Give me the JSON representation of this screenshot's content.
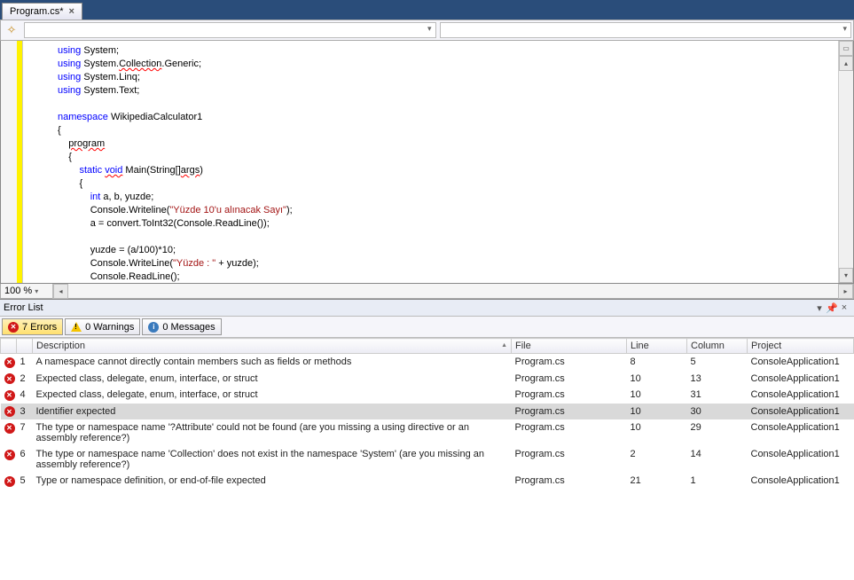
{
  "tab": {
    "title": "Program.cs*",
    "close": "×"
  },
  "zoom": "100 %",
  "code_lines": [
    {
      "indent": 0,
      "tokens": [
        {
          "t": "using ",
          "c": "kw"
        },
        {
          "t": "System;"
        }
      ],
      "box": "-",
      "boxLeft": -30
    },
    {
      "indent": 0,
      "tokens": [
        {
          "t": "using ",
          "c": "kw"
        },
        {
          "t": "System."
        },
        {
          "t": "Collection",
          "c": "squiggle"
        },
        {
          "t": ".Generic;"
        }
      ]
    },
    {
      "indent": 0,
      "tokens": [
        {
          "t": "using ",
          "c": "kw"
        },
        {
          "t": "System.Linq;"
        }
      ]
    },
    {
      "indent": 0,
      "tokens": [
        {
          "t": "using ",
          "c": "kw"
        },
        {
          "t": "System.Text;"
        }
      ]
    },
    {
      "indent": 0,
      "tokens": []
    },
    {
      "indent": 0,
      "tokens": [
        {
          "t": "namespace ",
          "c": "kw"
        },
        {
          "t": "WikipediaCalculator1"
        }
      ],
      "box": "-",
      "boxLeft": -30
    },
    {
      "indent": 0,
      "tokens": [
        {
          "t": "{"
        }
      ]
    },
    {
      "indent": 1,
      "tokens": [
        {
          "t": "program",
          "c": "squiggle"
        }
      ]
    },
    {
      "indent": 1,
      "tokens": [
        {
          "t": "{"
        }
      ]
    },
    {
      "indent": 2,
      "tokens": [
        {
          "t": "static ",
          "c": "kw"
        },
        {
          "t": "void",
          "c": "kw squiggle"
        },
        {
          "t": " Main(String"
        },
        {
          "t": "[]",
          "c": "squiggle"
        },
        {
          "t": "args",
          "c": "squiggle"
        },
        {
          "t": ")"
        }
      ]
    },
    {
      "indent": 2,
      "tokens": [
        {
          "t": "{"
        }
      ]
    },
    {
      "indent": 3,
      "tokens": [
        {
          "t": "int ",
          "c": "kw"
        },
        {
          "t": "a, b, yuzde;"
        }
      ]
    },
    {
      "indent": 3,
      "tokens": [
        {
          "t": "Console.Writeline("
        },
        {
          "t": "\"Yüzde 10'u alınacak Sayı\"",
          "c": "str"
        },
        {
          "t": ");"
        }
      ]
    },
    {
      "indent": 3,
      "tokens": [
        {
          "t": "a = convert.ToInt32(Console.ReadLine());"
        }
      ]
    },
    {
      "indent": 0,
      "tokens": []
    },
    {
      "indent": 3,
      "tokens": [
        {
          "t": "yuzde = (a/100)*10;"
        }
      ]
    },
    {
      "indent": 3,
      "tokens": [
        {
          "t": "Console.WriteLine("
        },
        {
          "t": "\"Yüzde : \"",
          "c": "str"
        },
        {
          "t": " + yuzde);"
        }
      ]
    },
    {
      "indent": 3,
      "tokens": [
        {
          "t": "Console.ReadLine();"
        }
      ]
    },
    {
      "indent": 3,
      "tokens": [
        {
          "t": "}"
        }
      ]
    },
    {
      "indent": 2,
      "tokens": [
        {
          "t": "}"
        }
      ]
    },
    {
      "indent": 1,
      "tokens": [
        {
          "t": "}",
          "c": "squiggle"
        }
      ]
    }
  ],
  "error_panel": {
    "title": "Error List",
    "filters": {
      "errors": "7 Errors",
      "warnings": "0 Warnings",
      "messages": "0 Messages"
    },
    "columns": [
      "",
      "",
      "Description",
      "File",
      "Line",
      "Column",
      "Project"
    ],
    "rows": [
      {
        "n": "1",
        "desc": "A namespace cannot directly contain members such as fields or methods",
        "file": "Program.cs",
        "line": "8",
        "col": "5",
        "proj": "ConsoleApplication1"
      },
      {
        "n": "2",
        "desc": "Expected class, delegate, enum, interface, or struct",
        "file": "Program.cs",
        "line": "10",
        "col": "13",
        "proj": "ConsoleApplication1"
      },
      {
        "n": "4",
        "desc": "Expected class, delegate, enum, interface, or struct",
        "file": "Program.cs",
        "line": "10",
        "col": "31",
        "proj": "ConsoleApplication1"
      },
      {
        "n": "3",
        "desc": "Identifier expected",
        "file": "Program.cs",
        "line": "10",
        "col": "30",
        "proj": "ConsoleApplication1",
        "sel": true
      },
      {
        "n": "7",
        "desc": "The type or namespace name '?Attribute' could not be found (are you missing a using directive or an assembly reference?)",
        "file": "Program.cs",
        "line": "10",
        "col": "29",
        "proj": "ConsoleApplication1"
      },
      {
        "n": "6",
        "desc": "The type or namespace name 'Collection' does not exist in the namespace 'System' (are you missing an assembly reference?)",
        "file": "Program.cs",
        "line": "2",
        "col": "14",
        "proj": "ConsoleApplication1"
      },
      {
        "n": "5",
        "desc": "Type or namespace definition, or end-of-file expected",
        "file": "Program.cs",
        "line": "21",
        "col": "1",
        "proj": "ConsoleApplication1"
      }
    ]
  }
}
